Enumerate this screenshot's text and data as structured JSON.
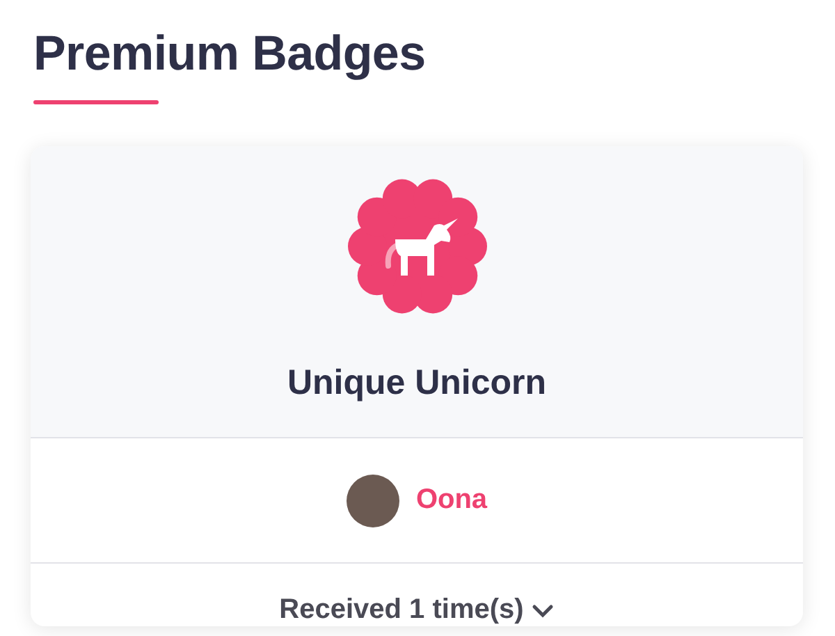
{
  "title": "Premium Badges",
  "badge": {
    "name": "Unique Unicorn"
  },
  "giver": {
    "name": "Oona"
  },
  "received": {
    "label": "Received 1 time(s)",
    "expanded": false
  }
}
